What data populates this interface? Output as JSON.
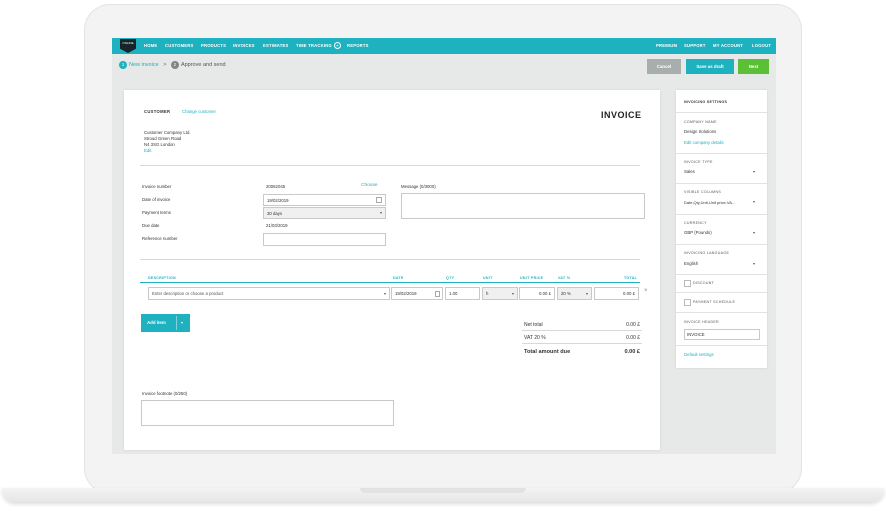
{
  "nav": {
    "logo": "ONLINE",
    "left": [
      "HOME",
      "CUSTOMERS",
      "PRODUCTS",
      "INVOICES",
      "ESTIMATES",
      "TIME TRACKING",
      "REPORTS"
    ],
    "right": [
      "PREMIUM",
      "SUPPORT",
      "MY ACCOUNT",
      "LOGOUT"
    ]
  },
  "steps": {
    "s1_num": "1",
    "s1_label": "New invoice",
    "sep": ">",
    "s2_num": "2",
    "s2_label": "Approve and send"
  },
  "actions": {
    "cancel": "Cancel",
    "draft": "Save as draft",
    "next": "Next"
  },
  "customer": {
    "label": "CUSTOMER",
    "change": "Change customer",
    "name": "Customer Company Ltd.",
    "street": "Stroud Green Road",
    "city": "N4 3SG London",
    "edit": "Edit"
  },
  "title": "INVOICE",
  "fields": {
    "invoice_number_label": "Invoice number",
    "invoice_number": "20062045",
    "choose": "Choose",
    "date_label": "Date of invoice",
    "date": "19/02/2019",
    "terms_label": "Payment terms",
    "terms": "30 days",
    "due_label": "Due date",
    "due": "21/03/2019",
    "ref_label": "Reference number",
    "message_label": "Message (0/3000)"
  },
  "items": {
    "headers": {
      "description": "DESCRIPTION",
      "date": "DATE",
      "qty": "QTY",
      "unit": "UNIT",
      "unit_price": "UNIT PRICE",
      "vat": "VAT %",
      "total": "TOTAL"
    },
    "row": {
      "description_placeholder": "Enter description or choose a product",
      "date": "19/02/2019",
      "qty": "1.00",
      "unit": "h",
      "unit_price": "0.00 £",
      "vat": "20 %",
      "total": "0.00 £"
    },
    "add_item": "Add item"
  },
  "totals": {
    "net_label": "Net total",
    "net": "0.00 £",
    "vat_label": "VAT 20 %",
    "vat": "0.00 £",
    "total_label": "Total amount due",
    "total": "0.00 £"
  },
  "footnote_label": "Invoice footnote (0/250)",
  "settings": {
    "title": "INVOICING SETTINGS",
    "company_label": "COMPANY NAME",
    "company": "Design Solutions",
    "edit_company": "Edit company details",
    "type_label": "INVOICE TYPE",
    "type": "Sales",
    "columns_label": "VISIBLE COLUMNS",
    "columns": "Date,Qty,Unit,Unit price,VA...",
    "currency_label": "CURRENCY",
    "currency": "GBP (Pounds)",
    "language_label": "INVOICING LANGUAGE",
    "language": "English",
    "discount": "DISCOUNT",
    "schedule": "PAYMENT SCHEDULE",
    "header_label": "INVOICE HEADER",
    "header": "INVOICE",
    "default": "Default settings"
  },
  "colors": {
    "teal": "#1eb1c0",
    "green": "#5cc036",
    "grey_btn": "#a7aeab",
    "dark": "#15252b"
  }
}
